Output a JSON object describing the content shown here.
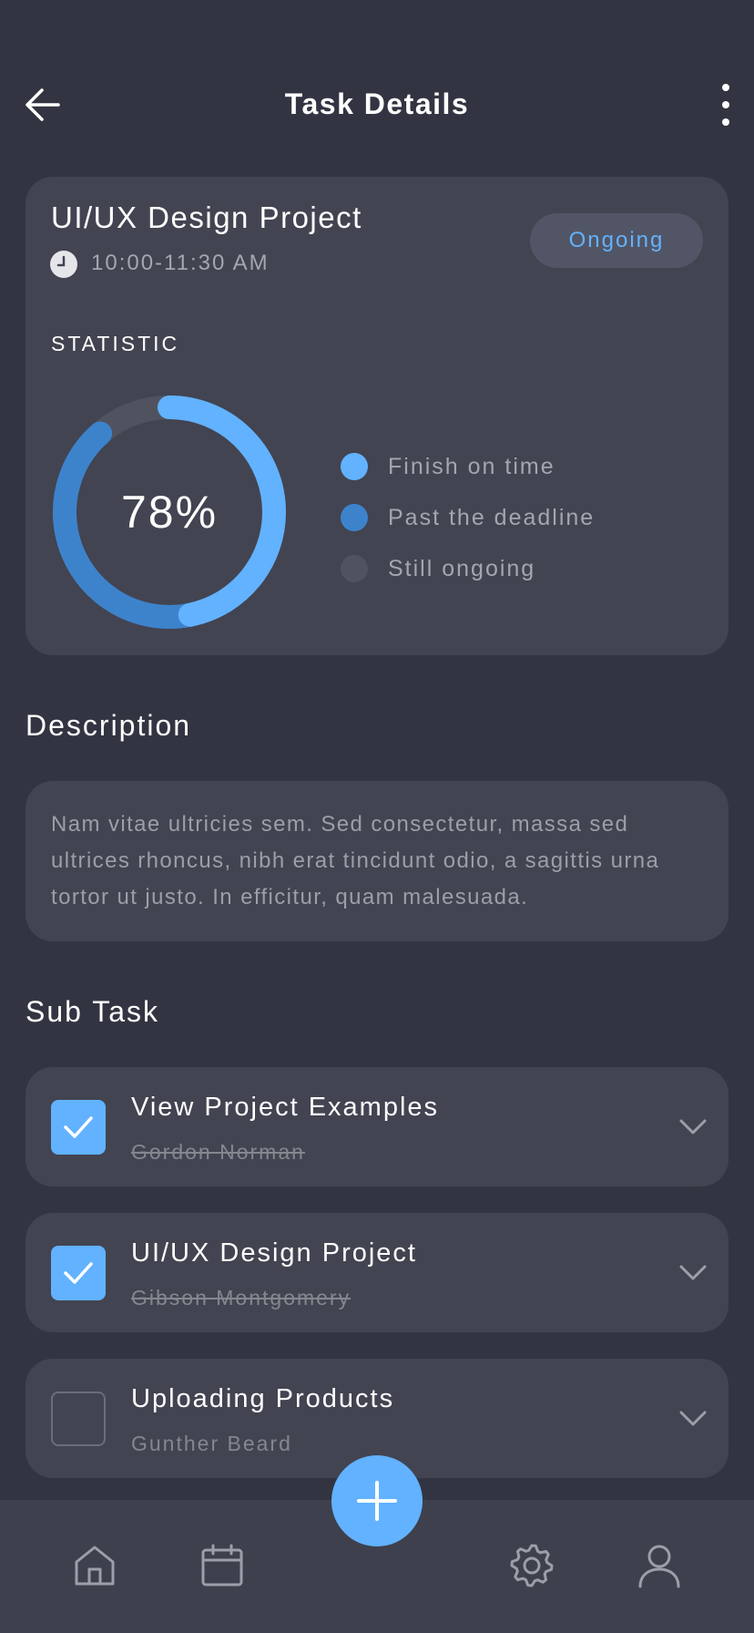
{
  "header": {
    "title": "Task Details"
  },
  "project": {
    "title": "UI/UX Design Project",
    "time": "10:00-11:30 AM",
    "status": "Ongoing"
  },
  "statistic": {
    "label": "STATISTIC",
    "percent_label": "78%",
    "finish_on_time_fraction": 0.78,
    "past_deadline_fraction": 0.22,
    "legend": [
      {
        "label": "Finish on time",
        "color": "#62b2ff"
      },
      {
        "label": "Past the deadline",
        "color": "#3d83cc"
      },
      {
        "label": "Still ongoing",
        "color": "#50535f"
      }
    ]
  },
  "description": {
    "heading": "Description",
    "text": "Nam vitae ultricies sem. Sed consectetur, massa sed ultrices rhoncus, nibh erat tincidunt odio, a sagittis urna tortor ut justo. In efficitur, quam malesuada."
  },
  "subtasks": {
    "heading": "Sub Task",
    "items": [
      {
        "title": "View Project Examples",
        "assignee": "Gordon Norman",
        "done": true
      },
      {
        "title": "UI/UX Design Project",
        "assignee": "Gibson Montgomery",
        "done": true
      },
      {
        "title": "Uploading Products",
        "assignee": "Gunther Beard",
        "done": false
      }
    ]
  },
  "nav": {
    "items": [
      "home-icon",
      "calendar-icon",
      "add-icon",
      "settings-icon",
      "profile-icon"
    ]
  },
  "colors": {
    "background": "#323541",
    "card": "#424451",
    "accent": "#62b2ff",
    "accent_dark": "#3d83cc"
  }
}
